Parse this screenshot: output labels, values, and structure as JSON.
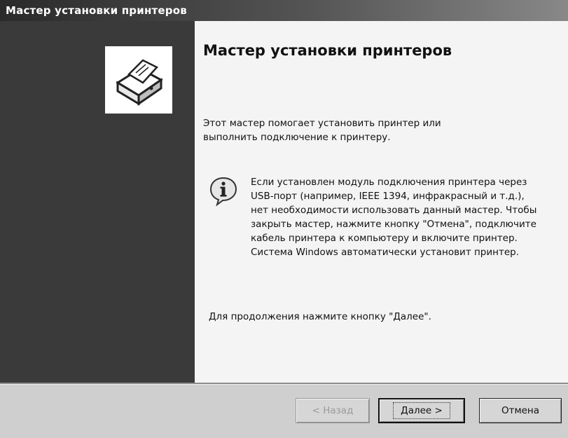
{
  "window": {
    "title": "Мастер установки принтеров"
  },
  "main": {
    "heading": "Мастер установки принтеров",
    "intro": "Этот мастер помогает установить принтер или выполнить подключение к принтеру.",
    "info_text": "Если установлен модуль подключения принтера через USB-порт (например, IEEE 1394, инфракрасный и т.д.), нет необходимости использовать данный мастер. Чтобы закрыть мастер, нажмите кнопку \"Отмена\", подключите кабель принтера к компьютеру и включите принтер. Система Windows автоматически установит принтер.",
    "continue_text": "Для продолжения нажмите кнопку \"Далее\"."
  },
  "icons": {
    "logo": "printer-wizard-icon",
    "info": "information-icon"
  },
  "buttons": {
    "back": "< Назад",
    "next": "Далее >",
    "cancel": "Отмена"
  },
  "colors": {
    "side_panel": "#3a3a3a",
    "content_bg": "#f4f4f4",
    "title_bar": "#2a2a2a"
  }
}
